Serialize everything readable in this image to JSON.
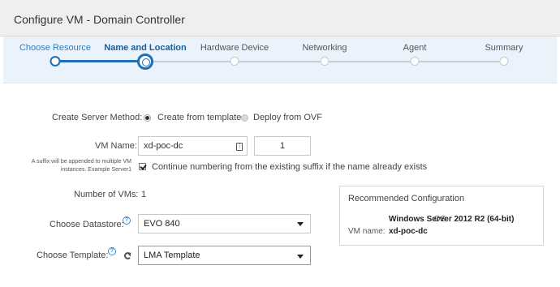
{
  "window": {
    "title": "Configure VM - Domain Controller"
  },
  "wizard": {
    "steps": [
      {
        "label": "Choose Resource",
        "state": "done"
      },
      {
        "label": "Name and Location",
        "state": "current"
      },
      {
        "label": "Hardware Device",
        "state": "pending"
      },
      {
        "label": "Networking",
        "state": "pending"
      },
      {
        "label": "Agent",
        "state": "pending"
      },
      {
        "label": "Summary",
        "state": "pending"
      }
    ]
  },
  "form": {
    "create_method": {
      "label": "Create Server Method:",
      "options": [
        {
          "label": "Create from template",
          "selected": true
        },
        {
          "label": "Deploy from OVF",
          "selected": false
        }
      ]
    },
    "vm_name": {
      "label": "VM Name:",
      "value": "xd-poc-dc",
      "suffix_value": "1",
      "hint": "A suffix will be appended to multiple VM instances. Example Server1",
      "continue_numbering_label": "Continue numbering from the existing suffix if the name already exists",
      "continue_numbering_checked": true
    },
    "num_vms": {
      "label": "Number of VMs:",
      "value": "1"
    },
    "datastore": {
      "label": "Choose Datastore:",
      "help": "?",
      "value": "EVO 840"
    },
    "template": {
      "label": "Choose Template:",
      "help": "?",
      "value": "LMA Template"
    }
  },
  "recommended": {
    "title": "Recommended Configuration",
    "os_label": "OS:",
    "os_value": "Windows Server 2012 R2 (64-bit)",
    "vmname_label": "VM name:",
    "vmname_value": "xd-poc-dc"
  },
  "colors": {
    "accent": "#1f6fb5",
    "wizard_bg": "#eaf2fb",
    "titlebar_bg": "#efefef"
  }
}
